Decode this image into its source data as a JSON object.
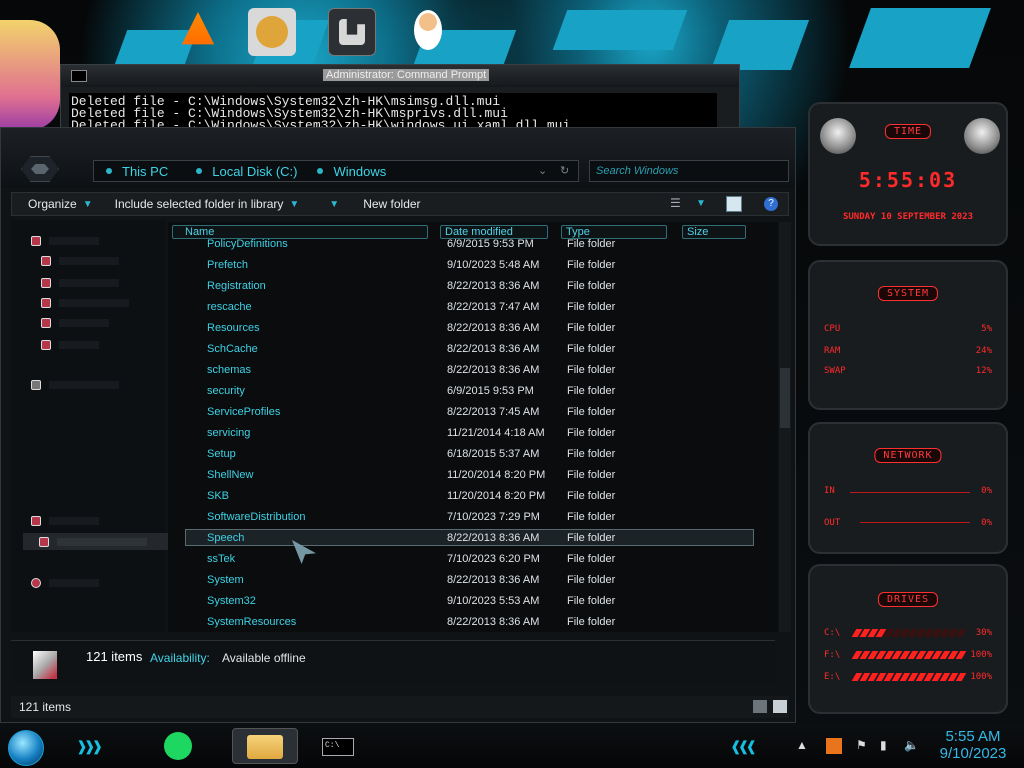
{
  "desktop": {
    "icons": [
      "star-vs-forces-icon",
      "vlc-icon",
      "hxd-icon",
      "hiew-icon",
      "doctor-app-icon"
    ]
  },
  "cmd": {
    "title": "Administrator: Command Prompt",
    "lines": [
      "Deleted file - C:\\Windows\\System32\\zh-HK\\msimsg.dll.mui",
      "Deleted file - C:\\Windows\\System32\\zh-HK\\msprivs.dll.mui",
      "Deleted file - C:\\Windows\\System32\\zh-HK\\windows.ui.xaml.dll.mui"
    ]
  },
  "explorer": {
    "breadcrumb": [
      "This PC",
      "Local Disk (C:)",
      "Windows"
    ],
    "search_placeholder": "Search Windows",
    "toolbar": {
      "organize": "Organize",
      "include": "Include selected folder in library",
      "new_folder": "New folder"
    },
    "columns": [
      "Name",
      "Date modified",
      "Type",
      "Size"
    ],
    "rows": [
      {
        "name": "PolicyDefinitions",
        "date": "6/9/2015 9:53 PM",
        "type": "File folder"
      },
      {
        "name": "Prefetch",
        "date": "9/10/2023 5:48 AM",
        "type": "File folder"
      },
      {
        "name": "Registration",
        "date": "8/22/2013 8:36 AM",
        "type": "File folder"
      },
      {
        "name": "rescache",
        "date": "8/22/2013 7:47 AM",
        "type": "File folder"
      },
      {
        "name": "Resources",
        "date": "8/22/2013 8:36 AM",
        "type": "File folder"
      },
      {
        "name": "SchCache",
        "date": "8/22/2013 8:36 AM",
        "type": "File folder"
      },
      {
        "name": "schemas",
        "date": "8/22/2013 8:36 AM",
        "type": "File folder"
      },
      {
        "name": "security",
        "date": "6/9/2015 9:53 PM",
        "type": "File folder"
      },
      {
        "name": "ServiceProfiles",
        "date": "8/22/2013 7:45 AM",
        "type": "File folder"
      },
      {
        "name": "servicing",
        "date": "11/21/2014 4:18 AM",
        "type": "File folder"
      },
      {
        "name": "Setup",
        "date": "6/18/2015 5:37 AM",
        "type": "File folder"
      },
      {
        "name": "ShellNew",
        "date": "11/20/2014 8:20 PM",
        "type": "File folder"
      },
      {
        "name": "SKB",
        "date": "11/20/2014 8:20 PM",
        "type": "File folder"
      },
      {
        "name": "SoftwareDistribution",
        "date": "7/10/2023 7:29 PM",
        "type": "File folder"
      },
      {
        "name": "Speech",
        "date": "8/22/2013 8:36 AM",
        "type": "File folder",
        "selected": true
      },
      {
        "name": "ssTek",
        "date": "7/10/2023 6:20 PM",
        "type": "File folder"
      },
      {
        "name": "System",
        "date": "8/22/2013 8:36 AM",
        "type": "File folder"
      },
      {
        "name": "System32",
        "date": "9/10/2023 5:53 AM",
        "type": "File folder"
      },
      {
        "name": "SystemResources",
        "date": "8/22/2013 8:36 AM",
        "type": "File folder"
      }
    ],
    "details": {
      "count": "121 items",
      "availability_label": "Availability:",
      "availability_value": "Available offline"
    },
    "status": "121 items"
  },
  "gadgets": {
    "time": {
      "title": "TIME",
      "clock": "5:55:03",
      "date": "SUNDAY 10 SEPTEMBER 2023"
    },
    "system": {
      "title": "SYSTEM",
      "rows": [
        {
          "label": "CPU",
          "value": "5%"
        },
        {
          "label": "RAM",
          "value": "24%"
        },
        {
          "label": "SWAP",
          "value": "12%"
        }
      ]
    },
    "network": {
      "title": "NETWORK",
      "in_label": "IN",
      "in_value": "0%",
      "out_label": "OUT",
      "out_value": "0%"
    },
    "drives": {
      "title": "DRIVES",
      "rows": [
        {
          "label": "C:\\",
          "value": "30%",
          "level": 0.3
        },
        {
          "label": "F:\\",
          "value": "100%",
          "level": 1.0
        },
        {
          "label": "E:\\",
          "value": "100%",
          "level": 1.0
        }
      ]
    }
  },
  "taskbar": {
    "time": "5:55 AM",
    "date": "9/10/2023"
  },
  "colors": {
    "accent": "#3fd3e6",
    "gadget_red": "#ff2a2a"
  }
}
